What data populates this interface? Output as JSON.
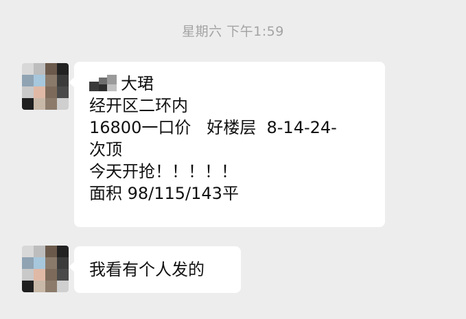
{
  "timestamp": "星期六 下午1:59",
  "messages": [
    {
      "sender": "other",
      "name_visible_part": "大珺",
      "lines": [
        "经开区二环内",
        "16800一口价   好楼层  8-14-24-",
        "次顶",
        "今天开抢！！！！！",
        "面积 98/115/143平"
      ]
    },
    {
      "sender": "other",
      "lines": [
        "我看有个人发的"
      ]
    }
  ],
  "colors": {
    "background": "#ededed",
    "bubble": "#ffffff",
    "timestamp": "#a3a3a3",
    "text": "#111111"
  }
}
